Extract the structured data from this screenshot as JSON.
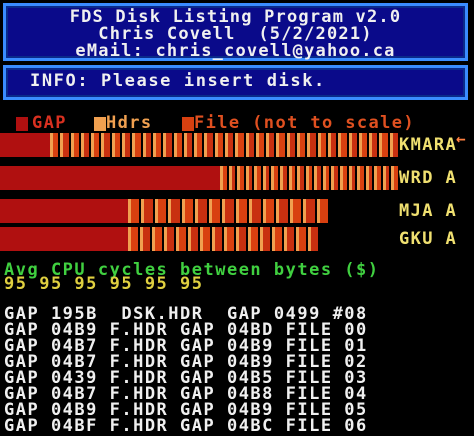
{
  "header": {
    "title": "FDS Disk Listing Program v2.0",
    "author": "Chris Covell  (5/2/2021)",
    "email": "eMail: chris_covell@yahoo.ca"
  },
  "info": {
    "text": "INFO: Please insert disk."
  },
  "legend": {
    "gap_label": "GAP",
    "hdrs_label": "Hdrs",
    "file_label": "File (not to scale)",
    "colors": {
      "gap": "#b01010",
      "hdrs": "#f0a050",
      "file": "#d84010",
      "accent": "#f0e070"
    }
  },
  "disks": [
    {
      "label": "KMARA",
      "segments": 34
    },
    {
      "label": "WRD A",
      "segments": 21
    },
    {
      "label": "MJA A",
      "segments": 15
    },
    {
      "label": "GKU A",
      "segments": 16
    }
  ],
  "cpu": {
    "title": "Avg CPU cycles between bytes ($)",
    "values": "95 95 95 95 95 95"
  },
  "files": [
    "GAP 195B  DSK.HDR  GAP 0499 #08",
    "GAP 04B9 F.HDR GAP 04BD FILE 00",
    "GAP 04B7 F.HDR GAP 04B9 FILE 01",
    "GAP 04B7 F.HDR GAP 04B9 FILE 02",
    "GAP 0439 F.HDR GAP 04B5 FILE 03",
    "GAP 04B7 F.HDR GAP 04B8 FILE 04",
    "GAP 04B9 F.HDR GAP 04B9 FILE 05",
    "GAP 04BF F.HDR GAP 04BC FILE 06"
  ]
}
